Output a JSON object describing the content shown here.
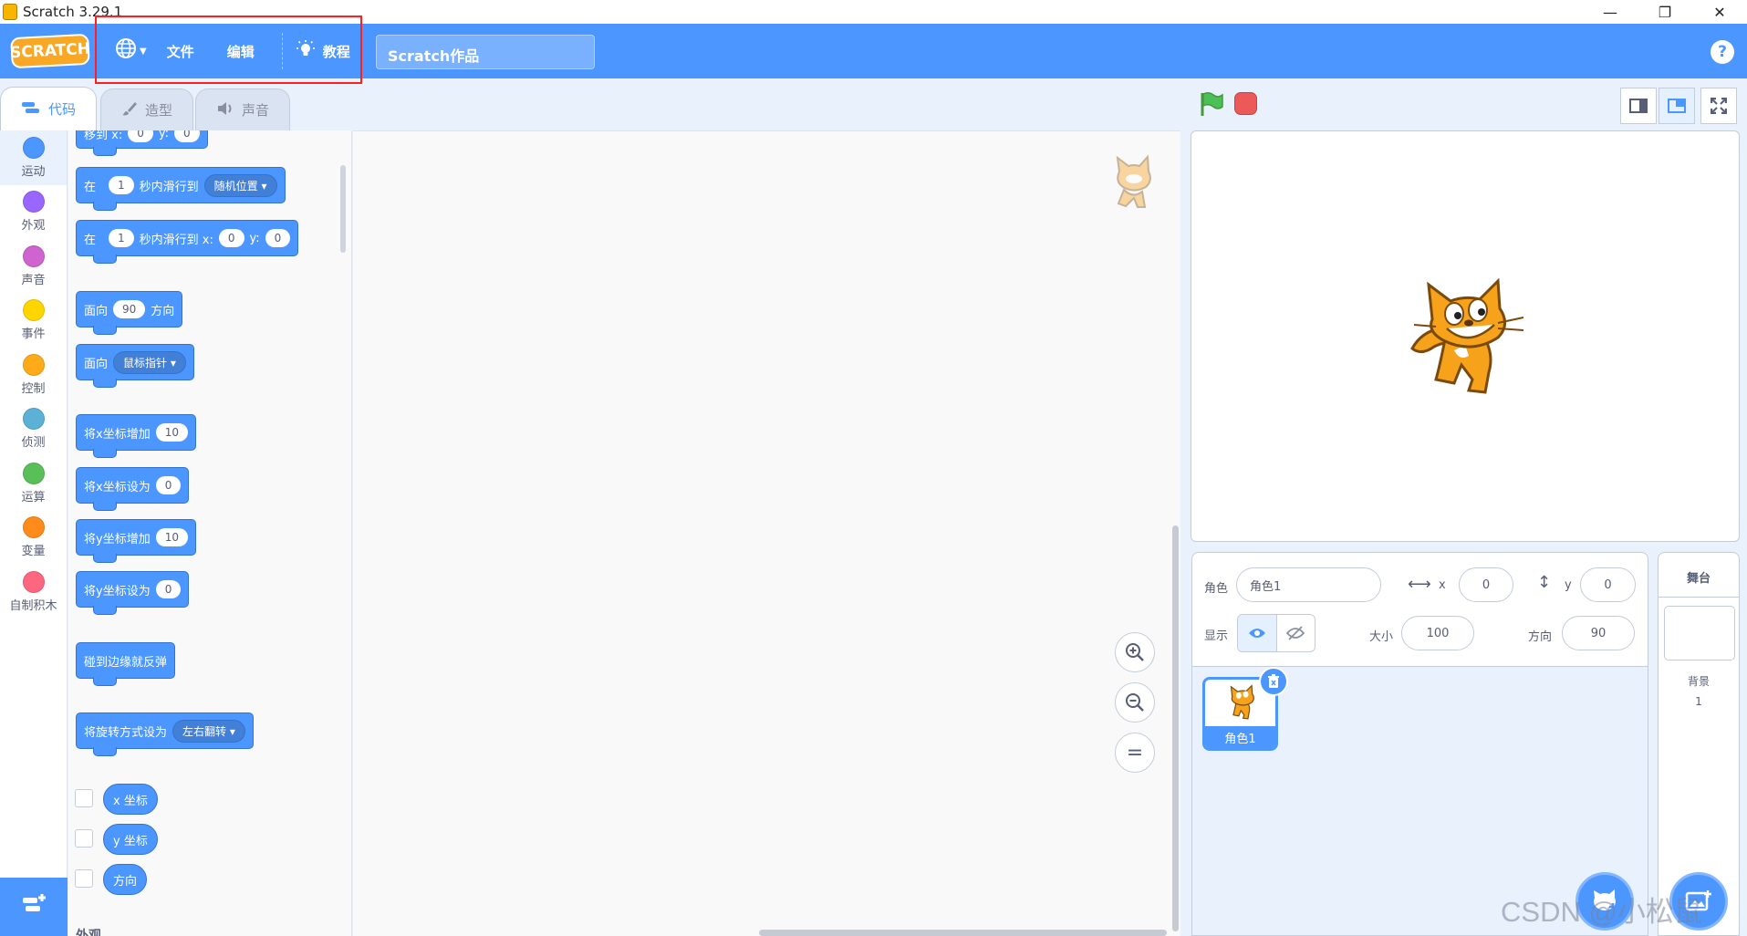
{
  "window": {
    "title": "Scratch 3.29.1",
    "minimize": "—",
    "restore": "❐",
    "close": "✕"
  },
  "menu": {
    "logo": "SCRATCH",
    "language_icon": "🌐",
    "file": "文件",
    "edit": "编辑",
    "tutorials": "教程",
    "project_title": "Scratch作品",
    "help": "?"
  },
  "tabs": [
    {
      "label": "代码"
    },
    {
      "label": "造型"
    },
    {
      "label": "声音"
    }
  ],
  "categories": [
    {
      "label": "运动",
      "color": "#4c97ff"
    },
    {
      "label": "外观",
      "color": "#9966ff"
    },
    {
      "label": "声音",
      "color": "#cf63cf"
    },
    {
      "label": "事件",
      "color": "#ffd500"
    },
    {
      "label": "控制",
      "color": "#ffab19"
    },
    {
      "label": "侦测",
      "color": "#5cb1d6"
    },
    {
      "label": "运算",
      "color": "#59c059"
    },
    {
      "label": "变量",
      "color": "#ff8c1a"
    },
    {
      "label": "自制积木",
      "color": "#ff6680"
    }
  ],
  "blocks": {
    "goto_xy": {
      "a": "移到 x:",
      "x": "0",
      "b": "y:",
      "y": "0"
    },
    "glide_to": {
      "a": "在",
      "secs": "1",
      "b": "秒内滑行到",
      "target": "随机位置"
    },
    "glide_xy": {
      "a": "在",
      "secs": "1",
      "b": "秒内滑行到 x:",
      "x": "0",
      "c": "y:",
      "y": "0"
    },
    "point_dir": {
      "a": "面向",
      "val": "90",
      "b": "方向"
    },
    "point_towards": {
      "a": "面向",
      "target": "鼠标指针"
    },
    "change_x": {
      "a": "将x坐标增加",
      "val": "10"
    },
    "set_x": {
      "a": "将x坐标设为",
      "val": "0"
    },
    "change_y": {
      "a": "将y坐标增加",
      "val": "10"
    },
    "set_y": {
      "a": "将y坐标设为",
      "val": "0"
    },
    "bounce": {
      "a": "碰到边缘就反弹"
    },
    "rotation": {
      "a": "将旋转方式设为",
      "val": "左右翻转"
    },
    "reporters": [
      "x 坐标",
      "y 坐标",
      "方向"
    ],
    "next_section": "外观"
  },
  "zoom": {
    "in": "+",
    "out": "−",
    "reset": "="
  },
  "sprite_info": {
    "sprite_label": "角色",
    "sprite_name": "角色1",
    "x_label": "x",
    "x_value": "0",
    "y_label": "y",
    "y_value": "0",
    "show_label": "显示",
    "size_label": "大小",
    "size_value": "100",
    "direction_label": "方向",
    "direction_value": "90"
  },
  "sprites": [
    {
      "name": "角色1"
    }
  ],
  "stage_panel": {
    "title": "舞台",
    "backdrops_label": "背景",
    "backdrops_count": "1"
  },
  "watermark": "CSDN @小松鼠"
}
